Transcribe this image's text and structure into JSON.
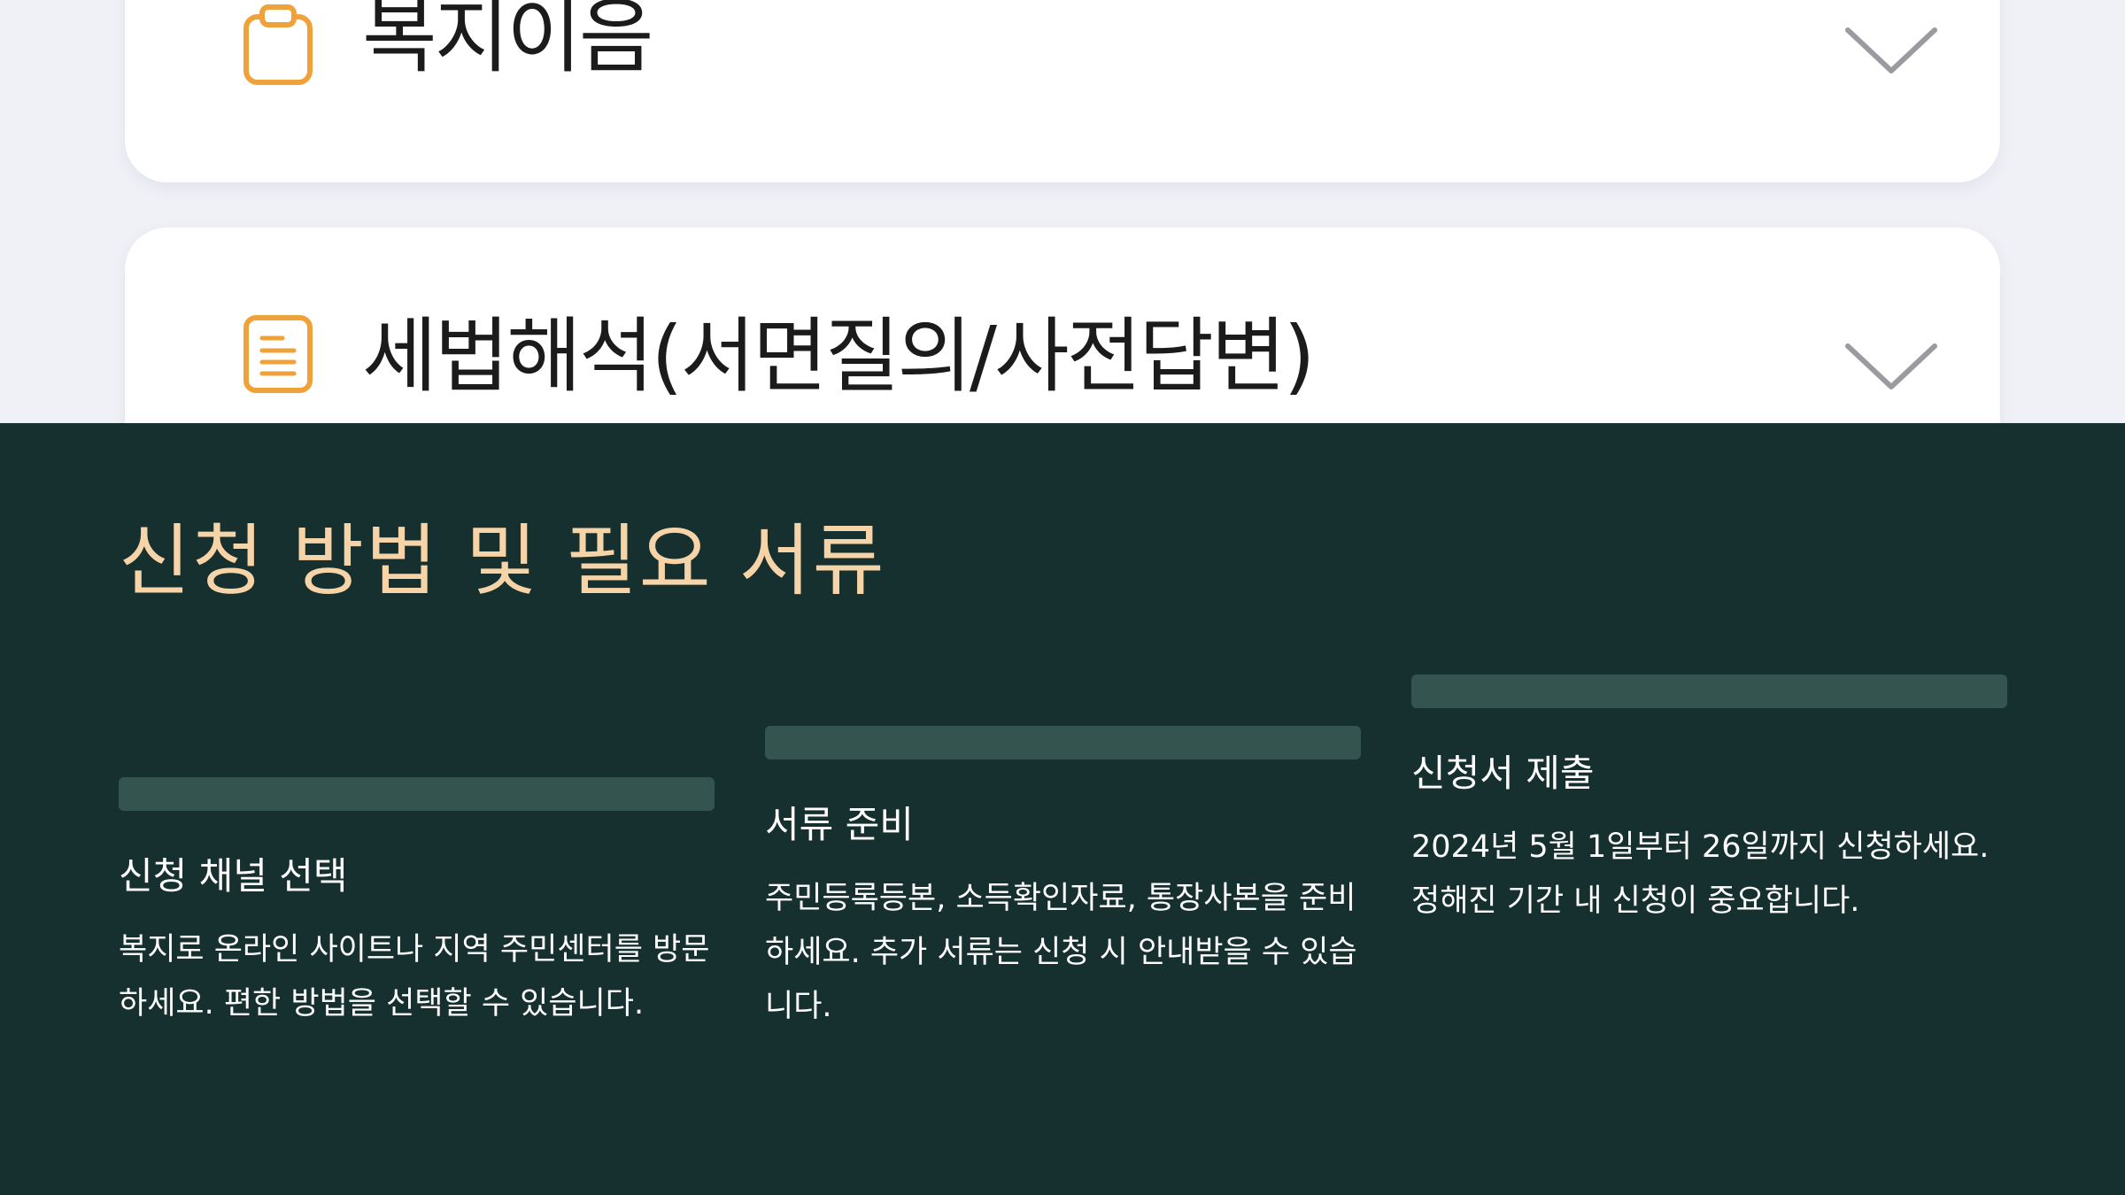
{
  "accordion": {
    "items": [
      {
        "title": "복지이음",
        "icon": "clipboard-icon",
        "state": "collapsed"
      },
      {
        "title": "세법해석(서면질의/사전답변)",
        "icon": "document-icon",
        "state": "collapsed"
      }
    ]
  },
  "section": {
    "title": "신청 방법 및 필요 서류",
    "steps": [
      {
        "title": "신청 채널 선택",
        "description": "복지로 온라인 사이트나 지역 주민센터를 방문하세요. 편한 방법을 선택할 수 있습니다."
      },
      {
        "title": "서류 준비",
        "description": "주민등록등본, 소득확인자료, 통장사본을 준비하세요. 추가 서류는 신청 시 안내받을 수 있습니다."
      },
      {
        "title": "신청서 제출",
        "description": "2024년 5월 1일부터 26일까지 신청하세요. 정해진 기간 내 신청이 중요합니다."
      }
    ]
  },
  "colors": {
    "top_background": "#f0f1f7",
    "card_background": "#ffffff",
    "icon_accent": "#f0a23a",
    "chevron": "#9a9aa0",
    "section_background": "#15302f",
    "section_title": "#f6d4a8",
    "step_bar": "#34544f",
    "step_text": "#ffffff"
  }
}
